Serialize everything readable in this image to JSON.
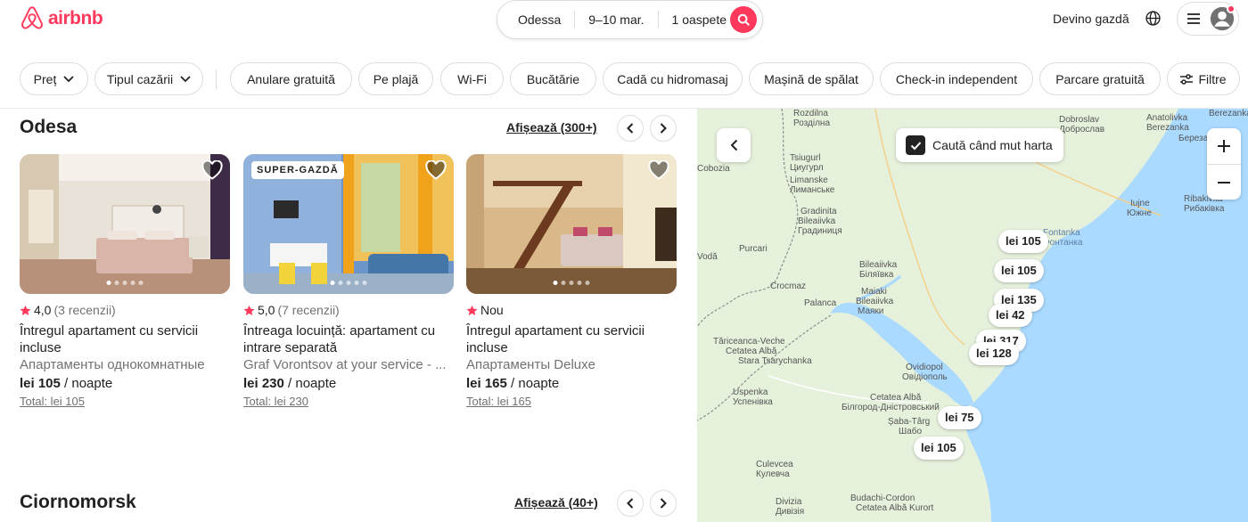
{
  "header": {
    "brand": "airbnb",
    "search": {
      "location": "Odessa",
      "dates": "9–10 mar.",
      "guests": "1 oaspete"
    },
    "host_link": "Devino gazdă"
  },
  "filters": {
    "chips": [
      "Preț",
      "Tipul cazării",
      "Anulare gratuită",
      "Pe plajă",
      "Wi-Fi",
      "Bucătărie",
      "Cadă cu hidromasaj",
      "Mașină de spălat",
      "Check-in independent",
      "Parcare gratuită",
      "Filtre"
    ]
  },
  "sections": [
    {
      "title": "Odesa",
      "show_all": "Afișează (300+)",
      "cards": [
        {
          "rating": "4,0",
          "reviews": "(3 recenzii)",
          "title": "Întregul apartament cu servicii incluse",
          "subtitle": "Апартаменты однокомнатные",
          "price": "lei 105",
          "price_unit": " / noapte",
          "total": "Total: lei 105",
          "badge": ""
        },
        {
          "rating": "5,0",
          "reviews": "(7 recenzii)",
          "title": "Întreaga locuință: apartament cu intrare separată",
          "subtitle": "Graf Vorontsov at your service - ...",
          "price": "lei 230",
          "price_unit": " / noapte",
          "total": "Total: lei 230",
          "badge": "SUPER-GAZDĂ"
        },
        {
          "rating": "Nou",
          "reviews": "",
          "title": "Întregul apartament cu servicii incluse",
          "subtitle": "Апартаменты Deluxe",
          "price": "lei 165",
          "price_unit": " / noapte",
          "total": "Total: lei 165",
          "badge": ""
        }
      ]
    },
    {
      "title": "Ciornomorsk",
      "show_all": "Afișează (40+)"
    }
  ],
  "map": {
    "search_as_move": "Caută când mut harta",
    "labels": [
      "Rozdilna",
      "Розділна",
      "Tsiugurl",
      "Циугурл",
      "Кучурган",
      "Limanske",
      "Лиманське",
      "Gradinita",
      "Градиниця",
      "Bileaiivka",
      "Біляївка",
      "Vodă",
      "Purcari",
      "Crocmaz",
      "Palanca",
      "Paлaнкa",
      "Maiaki",
      "Маяки",
      "Tăriceanca-Veche",
      "Cetatea Albă",
      "Stara Tsarychanka",
      "Ovidiopol",
      "Овідіополь",
      "Uspenka",
      "Успенівка",
      "Cetatea Albă",
      "Білгород-Дністровський",
      "Șaba-Târg",
      "Шабо",
      "Culevcea",
      "Кулевча",
      "Divizia",
      "Дивізія",
      "Budachi-Cordon",
      "Cetatea Albă Kurort",
      "Anatolivka",
      "Berezanka",
      "Березанка",
      "Dobroslav",
      "Доброслав",
      "Iujne",
      "Южне",
      "Ribakivka",
      "Рибаківка",
      "Berezanka",
      "Fontanka",
      "Фонтанка",
      "Cobozia"
    ],
    "pins": [
      "lei 105",
      "lei 105",
      "lei 135",
      "lei 42",
      "lei 317",
      "lei 128",
      "lei 75",
      "lei 105"
    ],
    "colors": {
      "land": "#e6f1dc",
      "water": "#aadaff",
      "accent": "#ff385c"
    }
  }
}
